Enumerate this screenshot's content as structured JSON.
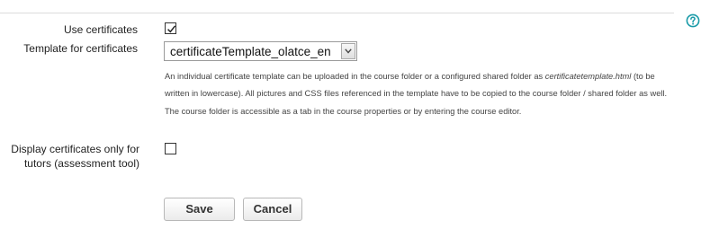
{
  "form": {
    "use_certificates": {
      "label": "Use certificates",
      "checked": true
    },
    "template": {
      "label": "Template for certificates",
      "selected": "certificateTemplate_olatce_en",
      "hint_part1": "An individual certificate template can be uploaded in the course folder or a configured shared folder as",
      "hint_filename": "certificatetemplate.html",
      "hint_part2": "(to be written in lowercase). All pictures and CSS files referenced in the template have to be copied to the course folder / shared folder as well. The course folder is accessible as a tab in the course properties or by entering the course editor."
    },
    "display_tutors_only": {
      "label_line1": "Display certificates only for",
      "label_line2": "tutors (assessment tool)",
      "checked": false
    }
  },
  "buttons": {
    "save": "Save",
    "cancel": "Cancel"
  },
  "help": {
    "icon": "help-icon",
    "color": "#1a9ba8"
  }
}
